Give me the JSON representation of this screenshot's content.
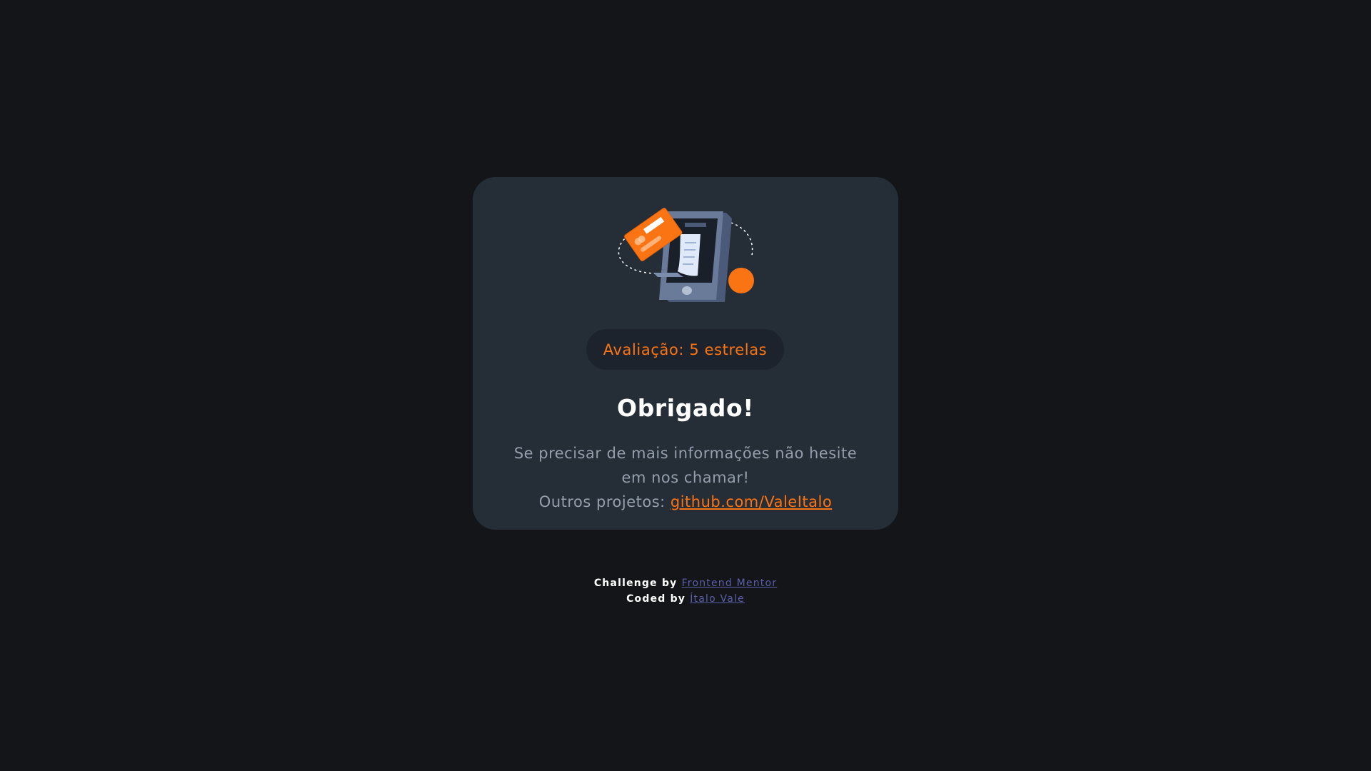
{
  "card": {
    "illustration_icon": "phone-payment-illustration",
    "rating_text": "Avaliação: 5 estrelas",
    "title": "Obrigado!",
    "message_line1": "Se precisar de mais informações não hesite",
    "message_line2": "em nos chamar!",
    "projects_label": "Outros projetos: ",
    "projects_link": "github.com/ValeItalo"
  },
  "attribution": {
    "challenge_label": "Challenge by ",
    "challenge_link": "Frontend Mentor",
    "coded_label": "Coded by ",
    "coded_link": "Ítalo Vale"
  },
  "colors": {
    "background": "#131518",
    "card": "#252d37",
    "accent": "#fb7413",
    "text_muted": "#959eac",
    "link_attribution": "#5b5fa8"
  }
}
